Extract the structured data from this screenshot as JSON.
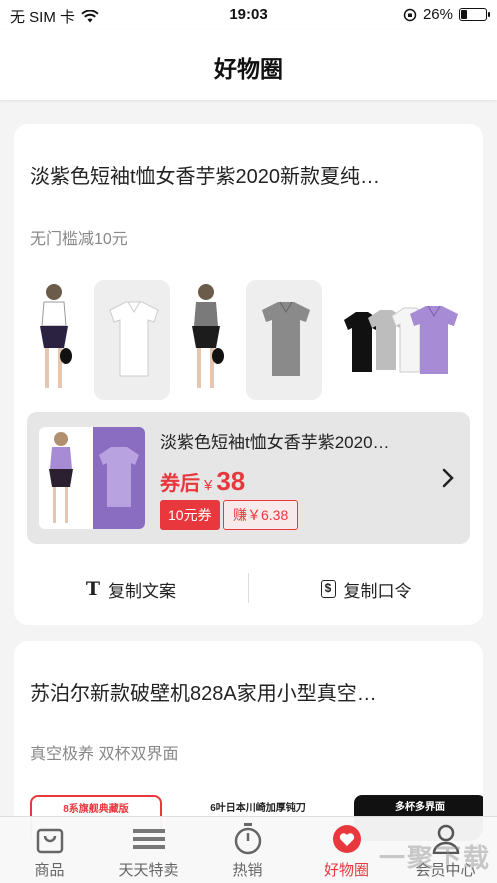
{
  "status_bar": {
    "carrier": "无 SIM 卡",
    "time": "19:03",
    "battery": "26%",
    "battery_level": 0.26
  },
  "header": {
    "title": "好物圈"
  },
  "card1": {
    "title": "淡紫色短袖t恤女香芋紫2020新款夏纯…",
    "subtitle": "无门槛减10元",
    "product": {
      "name": "淡紫色短袖t恤女香芋紫2020…",
      "price_label": "券后",
      "currency": "¥",
      "price": "38",
      "coupon": "10元券",
      "earn": "赚￥6.38"
    },
    "actions": {
      "copy_text": "复制文案",
      "copy_code": "复制口令"
    }
  },
  "card2": {
    "title": "苏泊尔新款破壁机828A家用小型真空…",
    "subtitle": "真空极养 双杯双界面",
    "banners": [
      "8系旗舰典藏版",
      "6叶日本川崎加厚钝刀",
      "多杯多界面"
    ]
  },
  "tabs": [
    {
      "label": "商品",
      "icon": "bag-icon"
    },
    {
      "label": "天天特卖",
      "icon": "list-icon"
    },
    {
      "label": "热销",
      "icon": "timer-icon"
    },
    {
      "label": "好物圈",
      "icon": "heart-icon"
    },
    {
      "label": "会员中心",
      "icon": "person-icon"
    }
  ],
  "watermark": "一聚下载",
  "colors": {
    "accent": "#e8383d",
    "purple": "#a78bd4"
  }
}
